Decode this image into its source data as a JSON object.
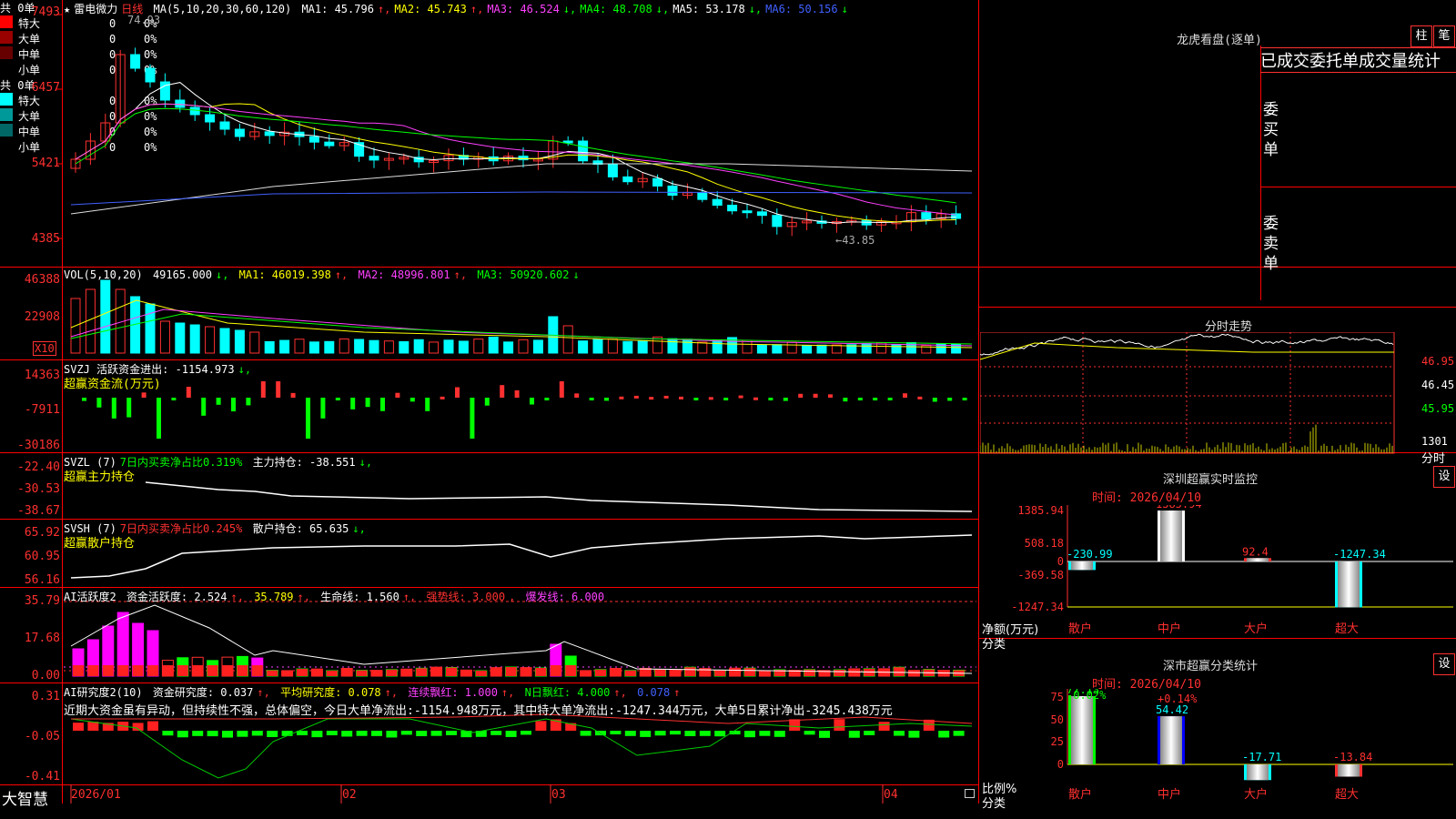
{
  "app": {
    "brand": "大智慧"
  },
  "kline": {
    "star": "★",
    "stock": "雷电微力",
    "period": "日线",
    "ma_label": "MA(5,10,20,30,60,120)",
    "ma": [
      {
        "k": "MA1:",
        "v": "45.796",
        "a": "↑",
        "color": "#ffffff"
      },
      {
        "k": "MA2:",
        "v": "45.743",
        "a": "↑",
        "color": "#ffff00"
      },
      {
        "k": "MA3:",
        "v": "46.524",
        "a": "↓",
        "color": "#ff40ff"
      },
      {
        "k": "MA4:",
        "v": "48.708",
        "a": "↓",
        "color": "#00ff00"
      },
      {
        "k": "MA5:",
        "v": "53.178",
        "a": "↓",
        "color": "#ffffff"
      },
      {
        "k": "MA6:",
        "v": "50.156",
        "a": "↓",
        "color": "#4060ff"
      }
    ],
    "y_ticks": [
      "7493",
      "6457",
      "5421",
      "4385"
    ],
    "high_mark": "74.93",
    "low_mark": "←43.85"
  },
  "vol": {
    "label": "VOL(5,10,20)",
    "val": "49165.000",
    "ma1": "MA1: 46019.398",
    "ma2": "MA2: 48996.801",
    "ma3": "MA3: 50920.602",
    "y_ticks": [
      "46388",
      "22908"
    ],
    "unit": "X10"
  },
  "svzj": {
    "label": "SVZJ  活跃资金进出: -1154.973",
    "sub": "超赢资金流(万元)",
    "y_ticks": [
      "14363",
      "-7911",
      "-30186"
    ]
  },
  "svzl": {
    "label": "SVZL (7)",
    "ratio": "7日内买卖净占比0.319%",
    "holding": "主力持仓: -38.551",
    "sub": "超赢主力持仓",
    "y_ticks": [
      "-22.40",
      "-30.53",
      "-38.67"
    ]
  },
  "svsh": {
    "label": "SVSH (7)",
    "ratio": "7日内买卖净占比0.245%",
    "holding": "散户持仓: 65.635",
    "sub": "超赢散户持仓",
    "y_ticks": [
      "65.92",
      "60.95",
      "56.16"
    ]
  },
  "ai1": {
    "label": "AI活跃度2",
    "active": "资金活跃度: 2.524",
    "v2": "35.789",
    "life": "生命线: 1.560",
    "strong": "强势线: 3.000",
    "burst": "爆发线: 6.000",
    "y_ticks": [
      "35.79",
      "17.68",
      "0.00"
    ]
  },
  "ai2": {
    "label": "AI研究度2(10)",
    "research": "资金研究度: 0.037",
    "avg": "平均研究度: 0.078",
    "cont": "连续飘红: 1.000",
    "nday": "N日飘红: 4.000",
    "last": "0.078",
    "comment": "近期大资金虽有异动，但持续性不强，总体偏空，今日大单净流出:-1154.948万元，其中特大单净流出:-1247.344万元，大单5日累计净出-3245.438万元",
    "y_ticks": [
      "0.31",
      "-0.05",
      "-0.41"
    ]
  },
  "xaxis": [
    "2026/01",
    "02",
    "03",
    "04"
  ],
  "lhb": {
    "title": "龙虎看盘(逐单)",
    "btn1": "柱",
    "btn2": "笔",
    "header": "已成交委托单成交量统计",
    "buy": {
      "side": "委买单",
      "total": "共 0单",
      "rows": [
        {
          "name": "特大",
          "n": "0",
          "p": "0%",
          "color": "#ff0000"
        },
        {
          "name": "大单",
          "n": "0",
          "p": "0%",
          "color": "#990000"
        },
        {
          "name": "中单",
          "n": "0",
          "p": "0%",
          "color": "#660000"
        },
        {
          "name": "小单",
          "n": "0",
          "p": "0%",
          "color": "#000000"
        }
      ]
    },
    "sell": {
      "side": "委卖单",
      "total": "共 0单",
      "rows": [
        {
          "name": "特大",
          "n": "0",
          "p": "0%",
          "color": "#00ffff"
        },
        {
          "name": "大单",
          "n": "0",
          "p": "0%",
          "color": "#009999"
        },
        {
          "name": "中单",
          "n": "0",
          "p": "0%",
          "color": "#006666"
        },
        {
          "name": "小单",
          "n": "0",
          "p": "0%",
          "color": "#000000"
        }
      ]
    }
  },
  "intraday": {
    "title": "分时走势",
    "y_ticks": [
      "46.95",
      "46.45",
      "45.95"
    ],
    "vol_tick": "1301",
    "unit": "分时"
  },
  "realtime": {
    "title": "深圳超赢实时监控",
    "set": "设",
    "time": "时间: 2026/04/10",
    "y_ticks": [
      "1385.94",
      "508.18",
      "0",
      "-369.58",
      "-1247.34"
    ],
    "ylabel": "净额(万元)",
    "xlabel": "分类",
    "cats": [
      "散户",
      "中户",
      "大户",
      "超大"
    ],
    "values": [
      -230.99,
      1385.94,
      92.4,
      -1247.34
    ],
    "labels": [
      "-230.99",
      "1385.94",
      "92.4",
      "-1247.34"
    ]
  },
  "classify": {
    "title": "深市超赢分类统计",
    "set": "设",
    "time": "时间: 2026/04/10",
    "y_ticks": [
      "75",
      "50",
      "25",
      "0"
    ],
    "ylabel": "比例%",
    "xlabel": "分类",
    "cats": [
      "散户",
      "中户",
      "大户",
      "超大"
    ],
    "values": [
      77.13,
      54.42,
      -17.71,
      -13.84
    ],
    "labels": [
      "77.13",
      "54.42",
      "-17.71",
      "-13.84"
    ],
    "top1": "-0.02%",
    "top2": "+0.14%"
  }
}
